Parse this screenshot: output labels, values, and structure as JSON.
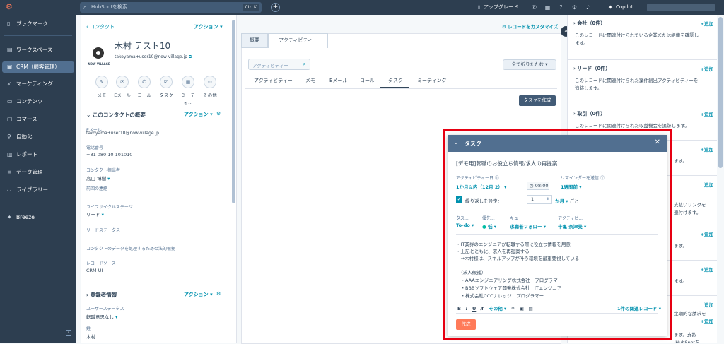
{
  "topbar": {
    "search_placeholder": "HubSpotを検索",
    "search_shortcut": "Ctrl K",
    "upgrade_label": "アップグレード",
    "copilot_label": "Copilot"
  },
  "sidebar": {
    "items": [
      {
        "label": "ブックマーク",
        "icon": "bookmark-icon"
      },
      {
        "label": "ワークスペース",
        "icon": "workspace-icon"
      },
      {
        "label": "CRM（顧客管理）",
        "icon": "crm-icon"
      },
      {
        "label": "マーケティング",
        "icon": "marketing-icon"
      },
      {
        "label": "コンテンツ",
        "icon": "content-icon"
      },
      {
        "label": "コマース",
        "icon": "commerce-icon"
      },
      {
        "label": "自動化",
        "icon": "automation-icon"
      },
      {
        "label": "レポート",
        "icon": "report-icon"
      },
      {
        "label": "データ管理",
        "icon": "data-icon"
      },
      {
        "label": "ライブラリー",
        "icon": "library-icon"
      },
      {
        "label": "Breeze",
        "icon": "breeze-icon"
      }
    ]
  },
  "contact": {
    "back_label": "コンタクト",
    "actions_label": "アクション",
    "logo_text": "NOW VILLAGE",
    "name": "木村 テスト10",
    "email": "takoyama+user10@now-village.jp",
    "activity_buttons": [
      "メモ",
      "Eメール",
      "コール",
      "タスク",
      "ミーティ...",
      "その他"
    ],
    "summary_title": "このコンタクトの概要",
    "summary_actions": "アクション",
    "fields": [
      {
        "label": "Eメール",
        "value": "takoyama+user10@now-village.jp"
      },
      {
        "label": "電話番号",
        "value": "+81 080 10 101010"
      },
      {
        "label": "コンタクト担当者",
        "value": "高山 博樹"
      },
      {
        "label": "前回の連絡",
        "value": "--"
      },
      {
        "label": "ライフサイクルステージ",
        "value": "リード"
      },
      {
        "label": "リードステータス",
        "value": ""
      },
      {
        "label": "コンタクトのデータを処理するための法的根拠",
        "value": ""
      },
      {
        "label": "レコードソース",
        "value": "CRM UI"
      }
    ],
    "registrant_title": "登録者情報",
    "registrant_actions": "アクション",
    "registrant_fields": [
      {
        "label": "ユーザーステータス",
        "value": "転職意思なし"
      },
      {
        "label": "姓",
        "value": "木村"
      }
    ]
  },
  "center": {
    "customize_label": "レコードをカスタマイズ",
    "tabs": [
      "概要",
      "アクティビティー"
    ],
    "activity_search_placeholder": "アクティビティー",
    "collapse_all": "全て折りたたむ",
    "filter_tabs": [
      "アクティビティー",
      "メモ",
      "Eメール",
      "コール",
      "タスク",
      "ミーティング"
    ],
    "create_task_button": "タスクを作成"
  },
  "right_panel": {
    "sections": [
      {
        "title": "会社（0件）",
        "add": "+追加",
        "text": "このレコードに関連付けられている企業または組織を確認します。"
      },
      {
        "title": "リード（0件）",
        "add": "+追加",
        "text": "このレコードに関連付けられた案件創出アクティビティーを追跡します。"
      },
      {
        "title": "取引（0件）",
        "add": "+追加",
        "text": "このレコードに関連付けられた収益機会を追跡します。"
      },
      {
        "title": "",
        "add": "+追加",
        "text": "ます。"
      },
      {
        "title": "",
        "add": "追加",
        "text": "支払いリンクを\n連付けます。"
      },
      {
        "title": "",
        "add": "+追加",
        "text": "ます。"
      },
      {
        "title": "",
        "add": "+追加",
        "text": "ます。"
      },
      {
        "title": "",
        "add": "追加",
        "text": "定期的な請求を"
      },
      {
        "title": "",
        "add": "+追加",
        "text": "ます。支払\n/HubSpotを\n追跡します。"
      }
    ]
  },
  "task_modal": {
    "header": "タスク",
    "title": "[デモ用]転職のお役立ち情報/求人の再提案",
    "date_label": "アクティビティー日",
    "date_value": "1か月以内（12月 2）",
    "time_value": "08:00",
    "reminder_label": "リマインダーを送信",
    "reminder_value": "1週間前",
    "repeat_label": "繰り返しを設定：",
    "repeat_count": "1",
    "repeat_unit": "か月",
    "repeat_suffix": "ごと",
    "type_label": "タス...",
    "type_value": "To-do",
    "priority_label": "優先...",
    "priority_value": "低",
    "queue_label": "キュー",
    "queue_value": "求職者フォロー",
    "assignee_label": "アクティビ...",
    "assignee_value": "十亀 奈津美",
    "body_lines": [
      "・IT業界のエンジニアが転職する際に役立つ情報を用意",
      "・上記とともに、求人を再提案する",
      "　→木村様は、スキルアップが叶う環境を最重要視している",
      "",
      "　（求人候補）",
      "　・AAAエンジニアリング株式会社　プログラマー",
      "　・BBBソフトウェア開発株式会社　ITエンジニア",
      "　・株式会社CCCナレッジ　プログラマー"
    ],
    "toolbar_more": "その他",
    "associated_records": "1件の関連レコード",
    "create_button": "作成"
  },
  "colors": {
    "nav_bg": "#2d3e50",
    "accent": "#0091ae",
    "brand_orange": "#ff7a59",
    "highlight_border": "#e60012"
  }
}
